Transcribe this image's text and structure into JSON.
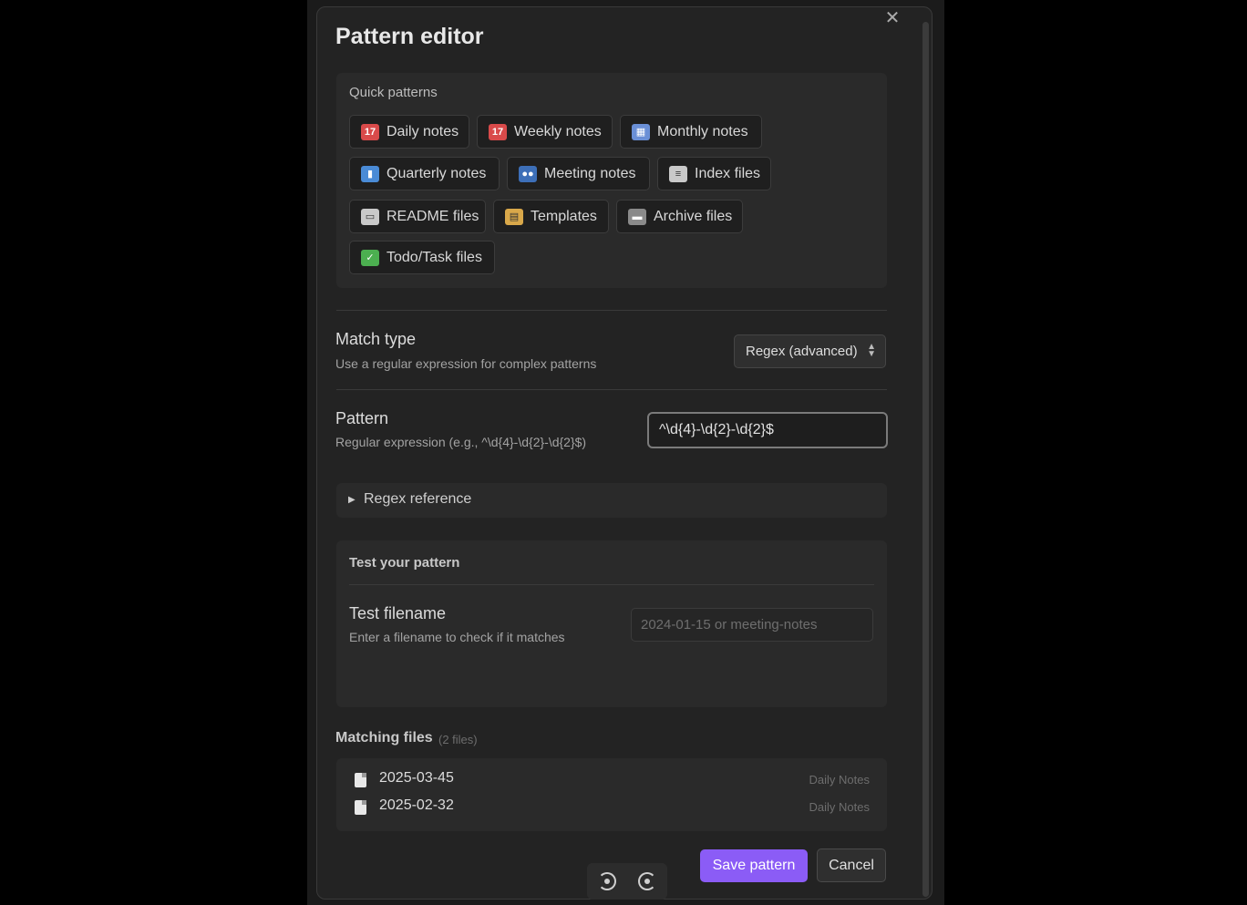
{
  "modal": {
    "title": "Pattern editor",
    "close_icon": "close-icon"
  },
  "quick_patterns": {
    "label": "Quick patterns",
    "chips": [
      {
        "label": "Daily notes",
        "icon": "calendar-icon",
        "color": "#d94a4a"
      },
      {
        "label": "Weekly notes",
        "icon": "calendar-icon",
        "color": "#d94a4a"
      },
      {
        "label": "Monthly notes",
        "icon": "spiral-calendar-icon",
        "color": "#6a8fd6"
      },
      {
        "label": "Quarterly notes",
        "icon": "bar-chart-icon",
        "color": "#4a8bd6"
      },
      {
        "label": "Meeting notes",
        "icon": "people-icon",
        "color": "#3d6fb8"
      },
      {
        "label": "Index files",
        "icon": "bookmark-tabs-icon",
        "color": "#c9c9c9"
      },
      {
        "label": "README files",
        "icon": "open-book-icon",
        "color": "#c9c9c9"
      },
      {
        "label": "Templates",
        "icon": "clipboard-icon",
        "color": "#d9a84a"
      },
      {
        "label": "Archive files",
        "icon": "card-file-box-icon",
        "color": "#8a8a8a"
      },
      {
        "label": "Todo/Task files",
        "icon": "check-mark-icon",
        "color": "#4caf50"
      }
    ]
  },
  "match_type": {
    "name": "Match type",
    "description": "Use a regular expression for complex patterns",
    "selected": "Regex (advanced)"
  },
  "pattern": {
    "name": "Pattern",
    "description": "Regular expression (e.g., ^\\d{4}-\\d{2}-\\d{2}$)",
    "value": "^\\d{4}-\\d{2}-\\d{2}$"
  },
  "regex_reference": {
    "label": "Regex reference"
  },
  "test": {
    "section_label": "Test your pattern",
    "name": "Test filename",
    "description": "Enter a filename to check if it matches",
    "placeholder": "2024-01-15 or meeting-notes",
    "value": ""
  },
  "matching_files": {
    "label": "Matching files",
    "count": "(2 files)",
    "files": [
      {
        "name": "2025-03-45",
        "folder": "Daily Notes"
      },
      {
        "name": "2025-02-32",
        "folder": "Daily Notes"
      }
    ]
  },
  "footer": {
    "save_label": "Save pattern",
    "cancel_label": "Cancel"
  }
}
